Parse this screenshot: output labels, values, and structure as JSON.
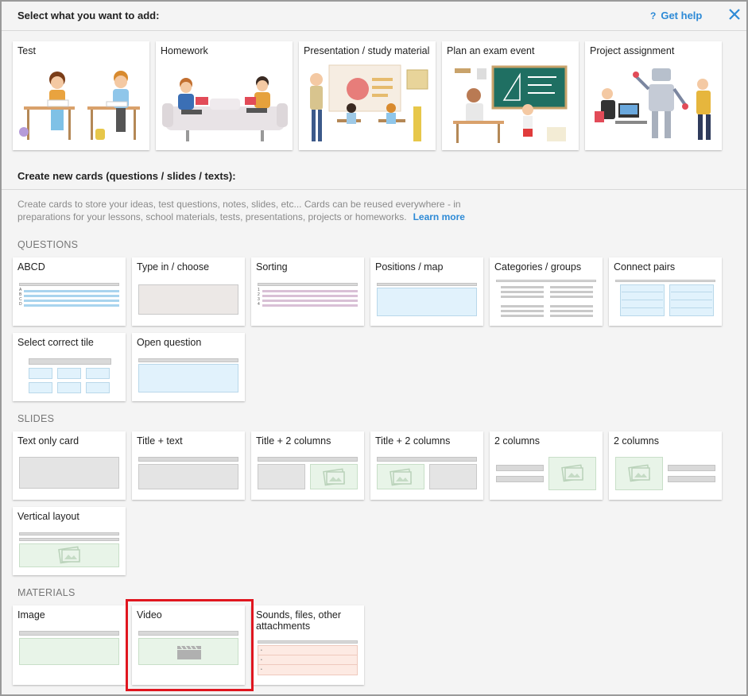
{
  "header": {
    "title": "Select what you want to add:",
    "help_icon": "?",
    "help_label": "Get help",
    "close_icon": "close-icon"
  },
  "top_cards": [
    {
      "label": "Test"
    },
    {
      "label": "Homework"
    },
    {
      "label": "Presentation / study material"
    },
    {
      "label": "Plan an exam event"
    },
    {
      "label": "Project assignment"
    }
  ],
  "create": {
    "title": "Create new cards (questions / slides / texts):",
    "description": "Create cards to store your ideas, test questions, notes, slides, etc... Cards can be reused everywhere - in preparations for your lessons, school materials, tests, presentations, projects or homeworks.",
    "learn_more": "Learn more"
  },
  "questions": {
    "title": "QUESTIONS",
    "cards": [
      {
        "label": "ABCD",
        "letters": [
          "A",
          "B",
          "C",
          "D"
        ]
      },
      {
        "label": "Type in / choose"
      },
      {
        "label": "Sorting",
        "numbers": [
          "1",
          "2",
          "3",
          "4"
        ]
      },
      {
        "label": "Positions / map"
      },
      {
        "label": "Categories / groups"
      },
      {
        "label": "Connect pairs"
      },
      {
        "label": "Select correct tile"
      },
      {
        "label": "Open question"
      }
    ]
  },
  "slides": {
    "title": "SLIDES",
    "cards": [
      {
        "label": "Text only card"
      },
      {
        "label": "Title + text"
      },
      {
        "label": "Title + 2 columns"
      },
      {
        "label": "Title + 2 columns"
      },
      {
        "label": "2 columns"
      },
      {
        "label": "2 columns"
      },
      {
        "label": "Vertical layout"
      }
    ]
  },
  "materials": {
    "title": "MATERIALS",
    "cards": [
      {
        "label": "Image"
      },
      {
        "label": "Video"
      },
      {
        "label": "Sounds, files, other attachments",
        "bullets": [
          "•",
          "•",
          "•"
        ]
      }
    ]
  },
  "colors": {
    "accent": "#2d8ad6",
    "highlight": "#e0161f"
  }
}
